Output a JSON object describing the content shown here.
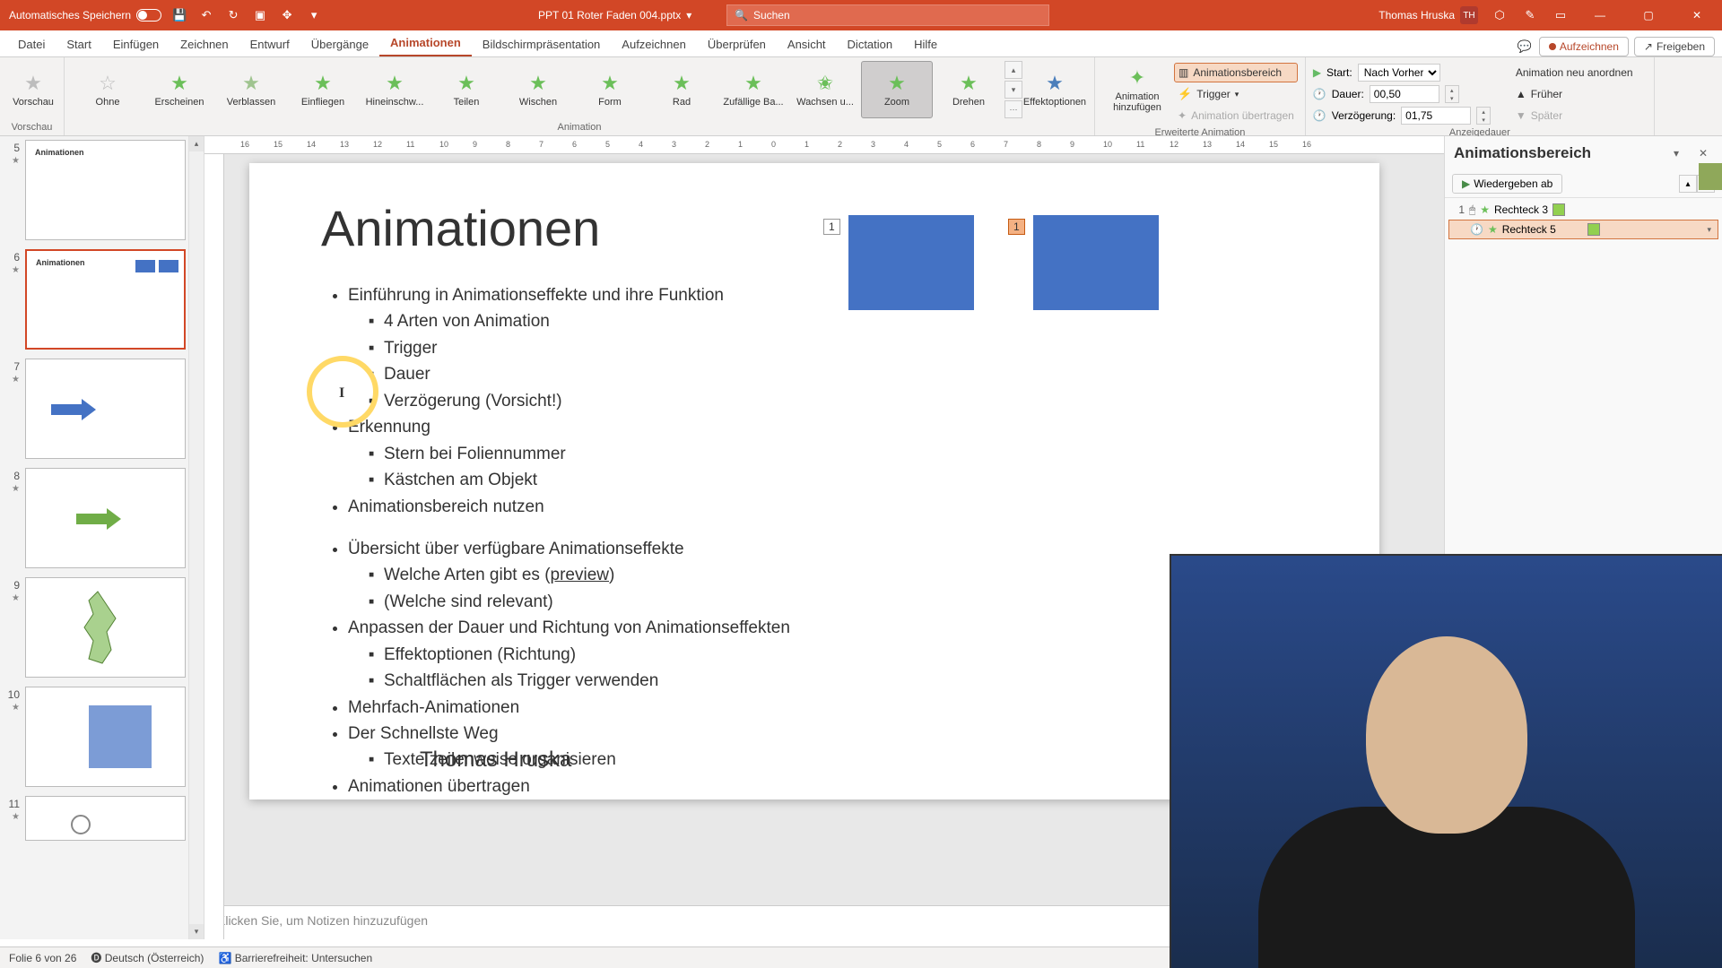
{
  "titlebar": {
    "autosave_label": "Automatisches Speichern",
    "filename": "PPT 01 Roter Faden 004.pptx",
    "search_placeholder": "Suchen",
    "user_name": "Thomas Hruska",
    "user_initials": "TH"
  },
  "tabs": {
    "datei": "Datei",
    "start": "Start",
    "einfuegen": "Einfügen",
    "zeichnen": "Zeichnen",
    "entwurf": "Entwurf",
    "uebergaenge": "Übergänge",
    "animationen": "Animationen",
    "bildschirm": "Bildschirmpräsentation",
    "aufzeichnen": "Aufzeichnen",
    "ueberpruefen": "Überprüfen",
    "ansicht": "Ansicht",
    "dictation": "Dictation",
    "hilfe": "Hilfe",
    "aufzeichnen_btn": "Aufzeichnen",
    "freigeben": "Freigeben"
  },
  "ribbon": {
    "vorschau": "Vorschau",
    "vorschau_grp": "Vorschau",
    "ohne": "Ohne",
    "erscheinen": "Erscheinen",
    "verblassen": "Verblassen",
    "einfliegen": "Einfliegen",
    "hineinschw": "Hineinschw...",
    "teilen": "Teilen",
    "wischen": "Wischen",
    "form": "Form",
    "rad": "Rad",
    "zufaellige": "Zufällige Ba...",
    "wachsen": "Wachsen u...",
    "zoom": "Zoom",
    "drehen": "Drehen",
    "effektopt": "Effektoptionen",
    "animation_grp": "Animation",
    "anim_hinzu": "Animation hinzufügen",
    "animbereich": "Animationsbereich",
    "trigger": "Trigger",
    "anim_uebertragen": "Animation übertragen",
    "erweiterte_grp": "Erweiterte Animation",
    "start_lbl": "Start:",
    "start_val": "Nach Vorher...",
    "dauer_lbl": "Dauer:",
    "dauer_val": "00,50",
    "verz_lbl": "Verzögerung:",
    "verz_val": "01,75",
    "neuanordnen": "Animation neu anordnen",
    "frueher": "Früher",
    "spaeter": "Später",
    "anzeigedauer_grp": "Anzeigedauer"
  },
  "thumbs": {
    "n5": "5",
    "n6": "6",
    "n7": "7",
    "n8": "8",
    "n9": "9",
    "n10": "10",
    "n11": "11"
  },
  "slide": {
    "title": "Animationen",
    "b1": "Einführung in Animationseffekte und ihre Funktion",
    "b1a": "4 Arten von Animation",
    "b1b": "Trigger",
    "b1c": "Dauer",
    "b1d": "Verzögerung (Vorsicht!)",
    "b2": "Erkennung",
    "b2a": "Stern bei Foliennummer",
    "b2b": "Kästchen am Objekt",
    "b3": "Animationsbereich nutzen",
    "b4": "Übersicht über verfügbare Animationseffekte",
    "b4a_pre": "Welche Arten gibt es (",
    "b4a_link": "preview",
    "b4a_post": ")",
    "b4b": "(Welche sind relevant)",
    "b5": "Anpassen der Dauer und Richtung von Animationseffekten",
    "b5a": "Effektoptionen (Richtung)",
    "b5b": "Schaltflächen als Trigger verwenden",
    "b6": "Mehrfach-Animationen",
    "b7": "Der Schnellste Weg",
    "b7a": "Texte zeilenweise organisieren",
    "b8": "Animationen übertragen",
    "presenter": "Thomas Hruska",
    "tag1": "1",
    "tag2": "1"
  },
  "notes": {
    "placeholder": "Klicken Sie, um Notizen hinzuzufügen"
  },
  "animpane": {
    "title": "Animationsbereich",
    "play": "Wiedergeben ab",
    "item1_num": "1",
    "item1": "Rechteck 3",
    "item2": "Rechteck 5"
  },
  "status": {
    "folie": "Folie 6 von 26",
    "lang": "Deutsch (Österreich)",
    "access": "Barrierefreiheit: Untersuchen"
  },
  "ruler": [
    "16",
    "15",
    "14",
    "13",
    "12",
    "11",
    "10",
    "9",
    "8",
    "7",
    "6",
    "5",
    "4",
    "3",
    "2",
    "1",
    "0",
    "1",
    "2",
    "3",
    "4",
    "5",
    "6",
    "7",
    "8",
    "9",
    "10",
    "11",
    "12",
    "13",
    "14",
    "15",
    "16"
  ]
}
